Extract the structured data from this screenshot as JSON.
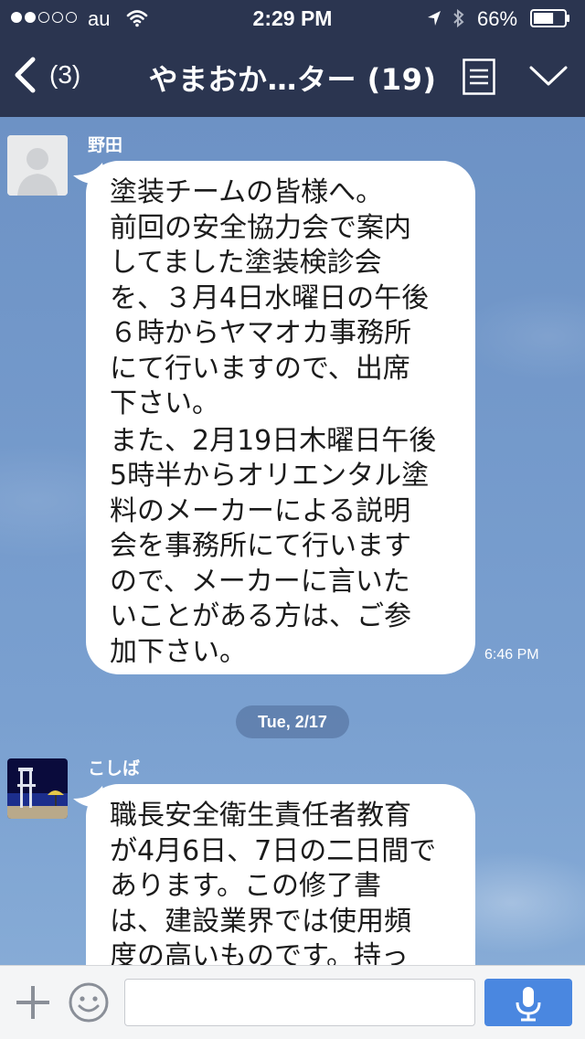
{
  "status_bar": {
    "carrier": "au",
    "time": "2:29 PM",
    "battery": "66%",
    "battery_level": 0.66,
    "signal_bars": 2
  },
  "header": {
    "back_count": "(3)",
    "title": "やまおか…ター (19)",
    "icons": {
      "back": "chevron-left-icon",
      "menu": "list-icon",
      "fold": "chevron-down-icon"
    }
  },
  "messages": [
    {
      "sender": "野田",
      "avatar": "default-person-avatar",
      "paragraphs": [
        "塗装チームの皆様へ。\n前回の安全協力会で案内\nしてました塗装検診会\nを、３月4日水曜日の午後\n６時からヤマオカ事務所\nにて行いますので、出席\n下さい。",
        "また、2月19日木曜日午後\n5時半からオリエンタル塗\n料のメーカーによる説明\n会を事務所にて行います\nので、メーカーに言いた\nいことがある方は、ご参\n加下さい。"
      ],
      "time": "6:46 PM"
    },
    {
      "sender": "こしば",
      "avatar": "beach-photo-avatar",
      "paragraphs": [
        "職長安全衛生責任者教育\nが4月6日、7日の二日間で\nあります。この修了書\nは、建設業界では使用頻\n度の高いものです。持っ"
      ]
    }
  ],
  "date_divider": "Tue, 2/17",
  "input_bar": {
    "placeholder": "",
    "icons": {
      "plus": "plus-icon",
      "emoji": "smiley-icon",
      "mic": "microphone-icon"
    }
  },
  "colors": {
    "header_bg": "#2b3550",
    "chat_bg": "#6f93c6",
    "bubble": "#ffffff",
    "mic_button": "#4a87e0"
  }
}
